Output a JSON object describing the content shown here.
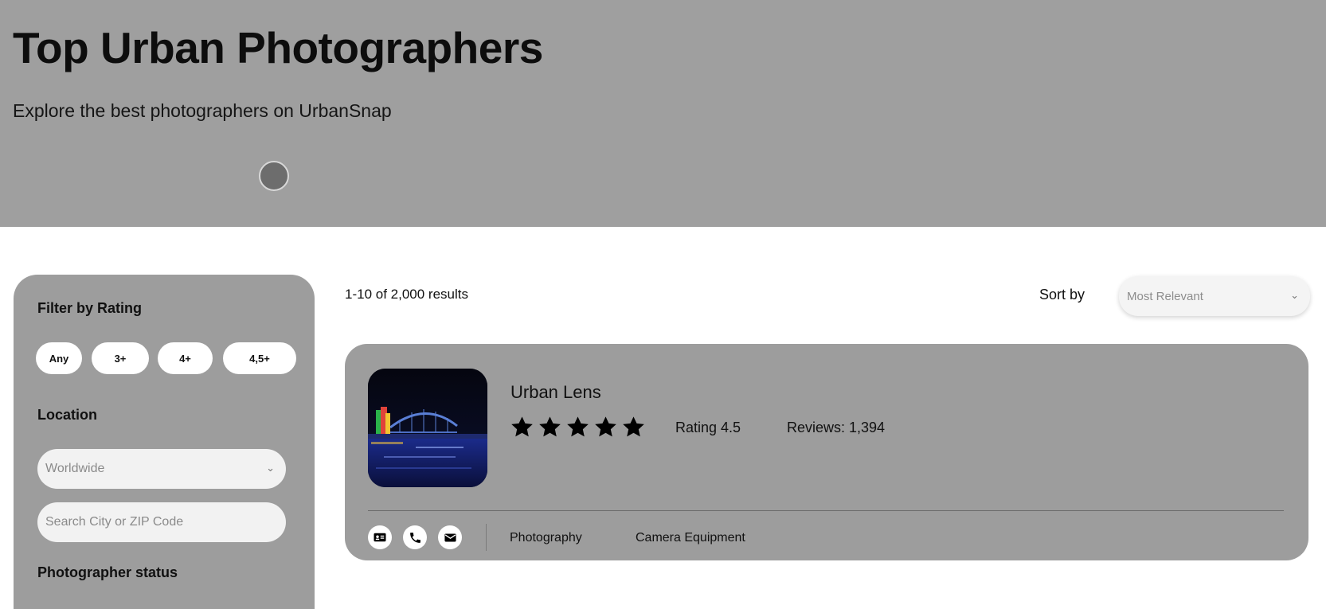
{
  "hero": {
    "title": "Top Urban Photographers",
    "subtitle": "Explore the best photographers on UrbanSnap"
  },
  "sidebar": {
    "rating_heading": "Filter by Rating",
    "rating_options": [
      "Any",
      "3+",
      "4+",
      "4,5+"
    ],
    "location_heading": "Location",
    "location_select": "Worldwide",
    "search_placeholder": "Search City or ZIP Code",
    "status_heading": "Photographer status"
  },
  "results": {
    "count": "1-10 of 2,000 results",
    "sort_label": "Sort by",
    "sort_value": "Most Relevant"
  },
  "card": {
    "name": "Urban Lens",
    "stars": 5,
    "rating": "Rating 4.5",
    "reviews": "Reviews: 1,394",
    "tags": [
      "Photography",
      "Camera Equipment"
    ],
    "icons": [
      "id-card-icon",
      "phone-icon",
      "mail-icon"
    ]
  },
  "colors": {
    "hero_bg": "#9f9f9f",
    "panel_bg": "#9d9d9d",
    "field_bg": "#f2f2f2"
  }
}
